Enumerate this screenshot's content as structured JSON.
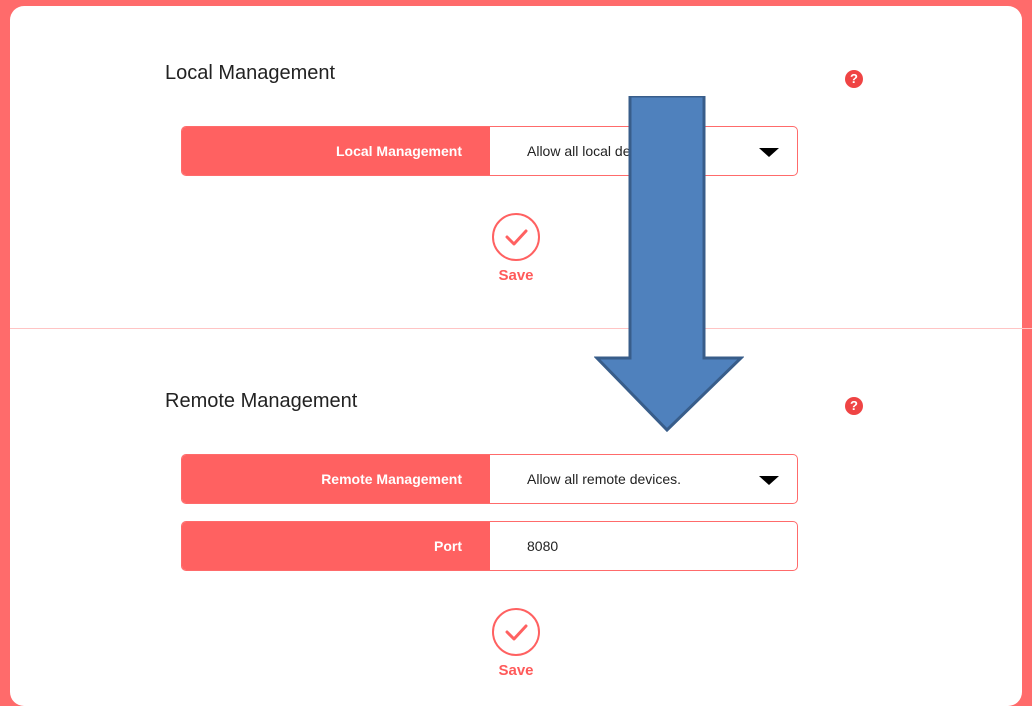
{
  "local_section": {
    "title": "Local Management",
    "help_icon": "?",
    "field": {
      "label": "Local Management",
      "selected_value": "Allow all local devices.",
      "icon": "chevron-down-icon"
    },
    "save_label": "Save"
  },
  "remote_section": {
    "title": "Remote Management",
    "help_icon": "?",
    "field": {
      "label": "Remote Management",
      "selected_value": "Allow all remote devices.",
      "icon": "chevron-down-icon"
    },
    "port": {
      "label": "Port",
      "value": "8080"
    },
    "save_label": "Save"
  },
  "colors": {
    "accent": "#ff6161",
    "background": "#ff6b6b",
    "arrow_fill": "#4f81bd",
    "arrow_stroke": "#385d8a"
  }
}
